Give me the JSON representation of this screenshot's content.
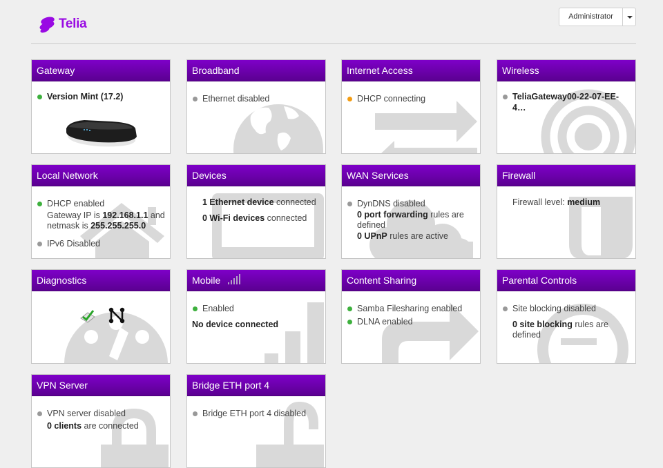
{
  "header": {
    "logo_text": "Telia",
    "user_label": "Administrator"
  },
  "colors": {
    "brand": "#990ae3",
    "header_gradient_top": "#7e00c8",
    "header_gradient_bottom": "#5b0091",
    "status_green": "#3db03d",
    "status_grey": "#999999",
    "status_orange": "#f39c12"
  },
  "cards": {
    "gateway": {
      "title": "Gateway",
      "version": "Version Mint (17.2)",
      "icon": "router-image"
    },
    "broadband": {
      "title": "Broadband",
      "status": "Ethernet disabled",
      "icon": "globe-icon"
    },
    "internet": {
      "title": "Internet Access",
      "status": "DHCP connecting",
      "icon": "arrows-icon"
    },
    "wireless": {
      "title": "Wireless",
      "ssid": "TeliaGateway00-22-07-EE-4…",
      "icon": "wifi-icon"
    },
    "local_network": {
      "title": "Local Network",
      "dhcp": "DHCP enabled",
      "gw_prefix": "Gateway IP is ",
      "gw_ip": "192.168.1.1",
      "gw_and": " and",
      "netmask_prefix": "netmask is ",
      "netmask": "255.255.255.0",
      "ipv6": "IPv6 Disabled",
      "icon": "home-icon"
    },
    "devices": {
      "title": "Devices",
      "eth_count": "1 Ethernet device",
      "eth_suffix": " connected",
      "wifi_count": "0 Wi-Fi devices",
      "wifi_suffix": " connected",
      "icon": "laptop-icon"
    },
    "wan": {
      "title": "WAN Services",
      "dyndns": "DynDNS disabled",
      "pf_count": "0 port forwarding",
      "pf_suffix": " rules are defined",
      "upnp_count": "0 UPnP",
      "upnp_suffix": " rules are active",
      "icon": "cloud-icon"
    },
    "firewall": {
      "title": "Firewall",
      "level_prefix": "Firewall level: ",
      "level": "medium",
      "icon": "shield-icon"
    },
    "diagnostics": {
      "title": "Diagnostics",
      "icon": "gauge-icon"
    },
    "mobile": {
      "title": "Mobile",
      "status": "Enabled",
      "device": "No device connected",
      "icon": "signal-bars-icon"
    },
    "content_sharing": {
      "title": "Content Sharing",
      "samba": "Samba Filesharing enabled",
      "dlna": "DLNA enabled",
      "icon": "share-icon"
    },
    "parental": {
      "title": "Parental Controls",
      "status": "Site blocking disabled",
      "count": "0 site blocking",
      "suffix": " rules are defined",
      "icon": "no-entry-icon"
    },
    "vpn": {
      "title": "VPN Server",
      "status": "VPN server disabled",
      "clients": "0 clients",
      "suffix": " are connected",
      "icon": "lock-icon"
    },
    "bridge": {
      "title": "Bridge ETH port 4",
      "status": "Bridge ETH port 4 disabled",
      "icon": "unlock-icon"
    }
  }
}
